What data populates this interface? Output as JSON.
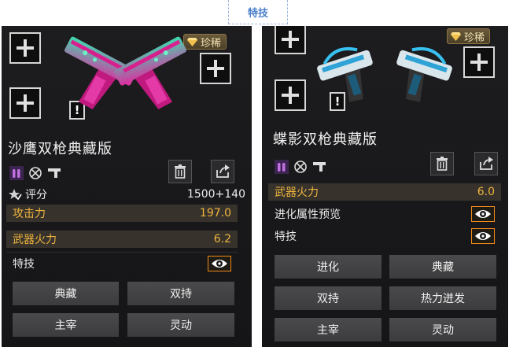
{
  "top_tab": {
    "label": "特技"
  },
  "left": {
    "rarity": "珍稀",
    "title": "沙鹰双枪典藏版",
    "excl": "!",
    "score_label": "评分",
    "score_value": "1500+140",
    "stats": [
      {
        "label": "攻击力",
        "value": "197.0"
      },
      {
        "label": "武器火力",
        "value": "6.2"
      }
    ],
    "skill_label": "特技",
    "tags": [
      "典藏",
      "双持",
      "主宰",
      "灵动"
    ]
  },
  "right": {
    "rarity": "珍稀",
    "title": "蝶影双枪典藏版",
    "excl": "!",
    "stat": {
      "label": "武器火力",
      "value": "6.0"
    },
    "evolve_preview_label": "进化属性预览",
    "skill_label": "特技",
    "tags": [
      "进化",
      "典藏",
      "双持",
      "热力迸发",
      "主宰",
      "灵动"
    ]
  },
  "colors": {
    "accent_gold": "#f0b43e",
    "eye_orange": "#f08a1a",
    "gun_left": "#d0208f",
    "gun_right": "#2fa3d6"
  },
  "icons": [
    "plus-icon",
    "diamond-icon",
    "trash-icon",
    "share-icon",
    "eye-icon",
    "star-check-icon"
  ]
}
